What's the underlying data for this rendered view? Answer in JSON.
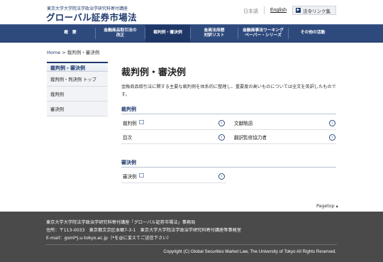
{
  "header": {
    "logo_sub": "東京大学大学院法学政治学研究科寄付講座",
    "logo_main": "グローバル証券市場法",
    "lang_ja": "日本語",
    "lang_en": "English",
    "link_button": "法令リンク集"
  },
  "nav": {
    "items": [
      {
        "label": "概　要"
      },
      {
        "label": "金融商品取引法の\n改正"
      },
      {
        "label": "裁判例・審決例"
      },
      {
        "label": "金商法用語\n対訳リスト"
      },
      {
        "label": "金融商事法ワーキング\nペーパー・シリーズ"
      },
      {
        "label": "その他の活動"
      }
    ]
  },
  "breadcrumb": {
    "home": "Home",
    "separator": " > ",
    "current": "裁判例・審決例"
  },
  "sidebar": {
    "title": "裁判例・審決例",
    "items": [
      {
        "label": "裁判例・判決例 トップ"
      },
      {
        "label": "裁判例"
      },
      {
        "label": "審決例"
      }
    ]
  },
  "main": {
    "title": "裁判例・審決例",
    "intro": "金融商品取引法に関する主要な裁判例を体系的に整理し、重要度の高いものについては全文を英訳したものです。",
    "section1": {
      "heading": "裁判例",
      "links": [
        {
          "label": "裁判例"
        },
        {
          "label": "文献略語"
        },
        {
          "label": "目次"
        },
        {
          "label": "翻訳監修協力者"
        }
      ]
    },
    "section2": {
      "heading": "審決例",
      "links": [
        {
          "label": "審決例"
        }
      ]
    },
    "pagetop": "Pagetop ▴"
  },
  "footer": {
    "line1": "東京大学大学院法学政治学研究科寄付講座「グローバル証券市場法」事務局",
    "line2": "住所：〒113-0033　東京都文京区本郷7-3-1　東京大学大学院法学政治学研究科寄付講座等事務室",
    "line3": "E-mail：gsml*j.u-tokyo.ac.jp（*を@に変えてご送信下さい）",
    "copyright": "Copyright (C) Global Securities Market Law, The University of Tokyo All Rights Reserved."
  },
  "icons": {
    "arrow": "arrow-right-circle-icon",
    "external": "external-window-icon"
  },
  "colors": {
    "nav_bg": "#2e4a7d",
    "nav_active": "#1f3766",
    "brand": "#1e3a6e",
    "footer_bg": "#4a4a4a"
  }
}
